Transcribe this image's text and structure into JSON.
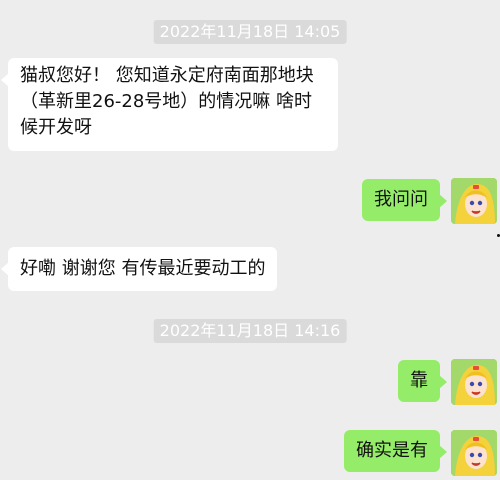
{
  "timestamps": [
    "2022年11月18日 14:05",
    "2022年11月18日 14:16"
  ],
  "messages": [
    {
      "side": "incoming",
      "text": "猫叔您好！ 您知道永定府南面那地块（革新里26-28号地）的情况嘛 啥时候开发呀"
    },
    {
      "side": "outgoing",
      "text": "我问问"
    },
    {
      "side": "incoming",
      "text": "好嘞 谢谢您 有传最近要动工的"
    },
    {
      "side": "outgoing",
      "text": "靠"
    },
    {
      "side": "outgoing",
      "text": "确实是有"
    }
  ],
  "colors": {
    "background": "#ededed",
    "incoming_bubble": "#ffffff",
    "outgoing_bubble": "#95ec69",
    "timestamp_bg": "#dadada"
  },
  "icons": {
    "avatar": "anime-girl-avatar-icon"
  }
}
